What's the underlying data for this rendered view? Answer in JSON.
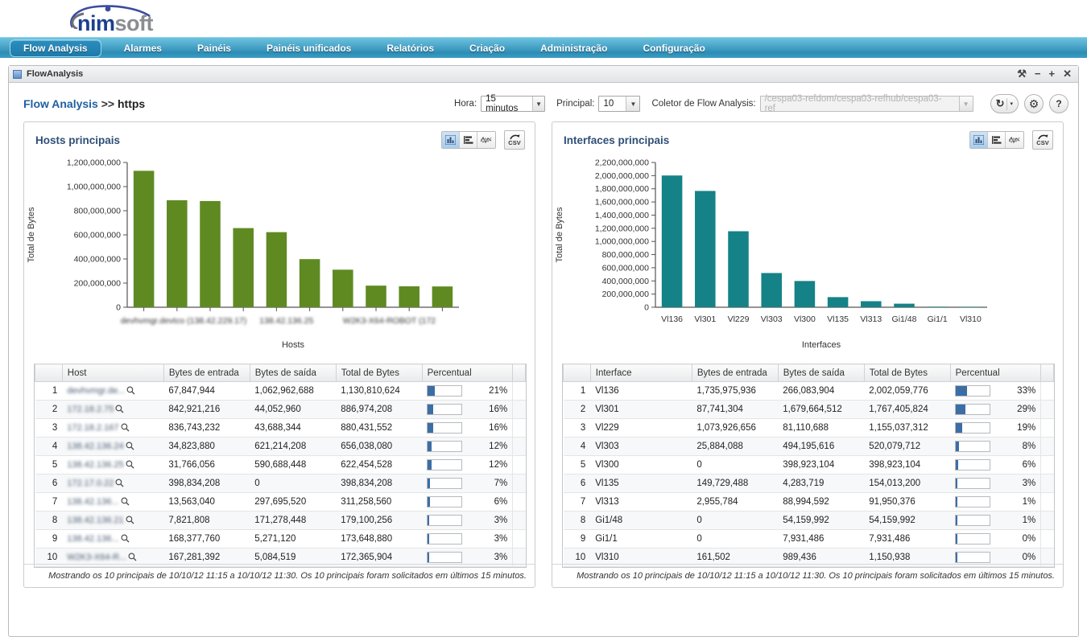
{
  "brand": {
    "nim": "nim",
    "soft": "soft"
  },
  "nav": {
    "items": [
      {
        "label": "Flow Analysis",
        "active": true
      },
      {
        "label": "Alarmes",
        "active": false
      },
      {
        "label": "Painéis",
        "active": false
      },
      {
        "label": "Painéis unificados",
        "active": false
      },
      {
        "label": "Relatórios",
        "active": false
      },
      {
        "label": "Criação",
        "active": false
      },
      {
        "label": "Administração",
        "active": false
      },
      {
        "label": "Configuração",
        "active": false
      }
    ]
  },
  "window": {
    "title": "FlowAnalysis",
    "controls": {
      "wrench": "⚒",
      "minimize": "−",
      "maximize": "+",
      "close": "✕"
    }
  },
  "toolbar": {
    "breadcrumb_root": "Flow Analysis",
    "breadcrumb_sep": " >> ",
    "breadcrumb_current": "https",
    "hora_label": "Hora:",
    "hora_value": "15 minutos",
    "principal_label": "Principal:",
    "principal_value": "10",
    "coletor_label": "Coletor de Flow Analysis:",
    "coletor_value": "/cespa03-refdom/cespa03-refhub/cespa03-ref",
    "refresh_icon": "↻",
    "refresh_caret": "▾",
    "settings_icon": "⚙",
    "help_icon": "?"
  },
  "colors": {
    "hosts_bar": "#5f8a22",
    "interfaces_bar": "#158287",
    "percent_bar": "#3b6ea5",
    "accent_blue": "#2d8cb5",
    "title_blue": "#2f4f77"
  },
  "chart_data": [
    {
      "type": "bar",
      "title": "Hosts principais",
      "xlabel": "Hosts",
      "ylabel": "Total de Bytes",
      "ylim": [
        0,
        1200000000
      ],
      "yticks": [
        0,
        200000000,
        400000000,
        600000000,
        800000000,
        1000000000,
        1200000000
      ],
      "ytick_labels": [
        "0",
        "200,000,000",
        "400,000,000",
        "600,000,000",
        "800,000,000",
        "1,000,000,000",
        "1,200,000,000"
      ],
      "grid": false,
      "bar_color": "#5f8a22",
      "categories": [
        "",
        "",
        "",
        "",
        "",
        "",
        "",
        "",
        "",
        ""
      ],
      "xtick_labels_visible": [
        "devhvmgr.devtco (138.42.229.17)",
        "138.42.136.25",
        "W2K3-X64-ROBOT (172"
      ],
      "xtick_label_blurred": true,
      "values": [
        1130810624,
        886974208,
        880431552,
        656038080,
        622454528,
        398834208,
        311258560,
        179100256,
        173648880,
        172365904
      ]
    },
    {
      "type": "bar",
      "title": "Interfaces principais",
      "xlabel": "Interfaces",
      "ylabel": "Total de Bytes",
      "ylim": [
        0,
        2200000000
      ],
      "yticks": [
        0,
        200000000,
        400000000,
        600000000,
        800000000,
        1000000000,
        1200000000,
        1400000000,
        1600000000,
        1800000000,
        2000000000,
        2200000000
      ],
      "ytick_labels": [
        "0",
        "200,000,000",
        "400,000,000",
        "600,000,000",
        "800,000,000",
        "1,000,000,000",
        "1,200,000,000",
        "1,400,000,000",
        "1,600,000,000",
        "1,800,000,000",
        "2,000,000,000",
        "2,200,000,000"
      ],
      "grid": false,
      "bar_color": "#158287",
      "categories": [
        "Vl136",
        "Vl301",
        "Vl229",
        "Vl303",
        "Vl300",
        "Vl135",
        "Vl313",
        "Gi1/48",
        "Gi1/1",
        "Vl310"
      ],
      "values": [
        2002059776,
        1767405824,
        1155037312,
        520079712,
        398923104,
        154013200,
        91950376,
        54159992,
        7931486,
        1150938
      ]
    }
  ],
  "hosts_panel": {
    "title": "Hosts principais",
    "chart_buttons": [
      "vertical-bar-chart",
      "horizontal-bar-chart",
      "line-chart"
    ],
    "selected_chart": "vertical-bar-chart",
    "csv_label": "CSV",
    "columns": [
      "",
      "Host",
      "Bytes de entrada",
      "Bytes de saída",
      "Total de Bytes",
      "Percentual",
      ""
    ],
    "rows": [
      {
        "rank": "1",
        "name": "devhvmgr.de...",
        "in": "67,847,944",
        "out": "1,062,962,688",
        "total": "1,130,810,624",
        "pct": "21%",
        "pct_val": 21
      },
      {
        "rank": "2",
        "name": "172.18.2.75",
        "in": "842,921,216",
        "out": "44,052,960",
        "total": "886,974,208",
        "pct": "16%",
        "pct_val": 16
      },
      {
        "rank": "3",
        "name": "172.18.2.167",
        "in": "836,743,232",
        "out": "43,688,344",
        "total": "880,431,552",
        "pct": "16%",
        "pct_val": 16
      },
      {
        "rank": "4",
        "name": "138.42.136.24",
        "in": "34,823,880",
        "out": "621,214,208",
        "total": "656,038,080",
        "pct": "12%",
        "pct_val": 12
      },
      {
        "rank": "5",
        "name": "138.42.136.25",
        "in": "31,766,056",
        "out": "590,688,448",
        "total": "622,454,528",
        "pct": "12%",
        "pct_val": 12
      },
      {
        "rank": "6",
        "name": "172.17.0.22",
        "in": "398,834,208",
        "out": "0",
        "total": "398,834,208",
        "pct": "7%",
        "pct_val": 7
      },
      {
        "rank": "7",
        "name": "138.42.136...",
        "in": "13,563,040",
        "out": "297,695,520",
        "total": "311,258,560",
        "pct": "6%",
        "pct_val": 6
      },
      {
        "rank": "8",
        "name": "138.42.136.21",
        "in": "7,821,808",
        "out": "171,278,448",
        "total": "179,100,256",
        "pct": "3%",
        "pct_val": 3
      },
      {
        "rank": "9",
        "name": "138.42.136...",
        "in": "168,377,760",
        "out": "5,271,120",
        "total": "173,648,880",
        "pct": "3%",
        "pct_val": 3
      },
      {
        "rank": "10",
        "name": "W2K3-X64-R...",
        "in": "167,281,392",
        "out": "5,084,519",
        "total": "172,365,904",
        "pct": "3%",
        "pct_val": 3
      }
    ],
    "footer": "Mostrando os 10 principais de 10/10/12 11:15 a 10/10/12 11:30. Os 10 principais foram solicitados em últimos 15 minutos."
  },
  "interfaces_panel": {
    "title": "Interfaces principais",
    "chart_buttons": [
      "vertical-bar-chart",
      "horizontal-bar-chart",
      "line-chart"
    ],
    "selected_chart": "vertical-bar-chart",
    "csv_label": "CSV",
    "columns": [
      "",
      "Interface",
      "Bytes de entrada",
      "Bytes de saída",
      "Total de Bytes",
      "Percentual",
      ""
    ],
    "rows": [
      {
        "rank": "1",
        "name": "Vl136",
        "in": "1,735,975,936",
        "out": "266,083,904",
        "total": "2,002,059,776",
        "pct": "33%",
        "pct_val": 33
      },
      {
        "rank": "2",
        "name": "Vl301",
        "in": "87,741,304",
        "out": "1,679,664,512",
        "total": "1,767,405,824",
        "pct": "29%",
        "pct_val": 29
      },
      {
        "rank": "3",
        "name": "Vl229",
        "in": "1,073,926,656",
        "out": "81,110,688",
        "total": "1,155,037,312",
        "pct": "19%",
        "pct_val": 19
      },
      {
        "rank": "4",
        "name": "Vl303",
        "in": "25,884,088",
        "out": "494,195,616",
        "total": "520,079,712",
        "pct": "8%",
        "pct_val": 8
      },
      {
        "rank": "5",
        "name": "Vl300",
        "in": "0",
        "out": "398,923,104",
        "total": "398,923,104",
        "pct": "6%",
        "pct_val": 6
      },
      {
        "rank": "6",
        "name": "Vl135",
        "in": "149,729,488",
        "out": "4,283,719",
        "total": "154,013,200",
        "pct": "3%",
        "pct_val": 3
      },
      {
        "rank": "7",
        "name": "Vl313",
        "in": "2,955,784",
        "out": "88,994,592",
        "total": "91,950,376",
        "pct": "1%",
        "pct_val": 1
      },
      {
        "rank": "8",
        "name": "Gi1/48",
        "in": "0",
        "out": "54,159,992",
        "total": "54,159,992",
        "pct": "1%",
        "pct_val": 1
      },
      {
        "rank": "9",
        "name": "Gi1/1",
        "in": "0",
        "out": "7,931,486",
        "total": "7,931,486",
        "pct": "0%",
        "pct_val": 0
      },
      {
        "rank": "10",
        "name": "Vl310",
        "in": "161,502",
        "out": "989,436",
        "total": "1,150,938",
        "pct": "0%",
        "pct_val": 0
      }
    ],
    "footer": "Mostrando os 10 principais de 10/10/12 11:15 a 10/10/12 11:30. Os 10 principais foram solicitados em últimos 15 minutos."
  }
}
